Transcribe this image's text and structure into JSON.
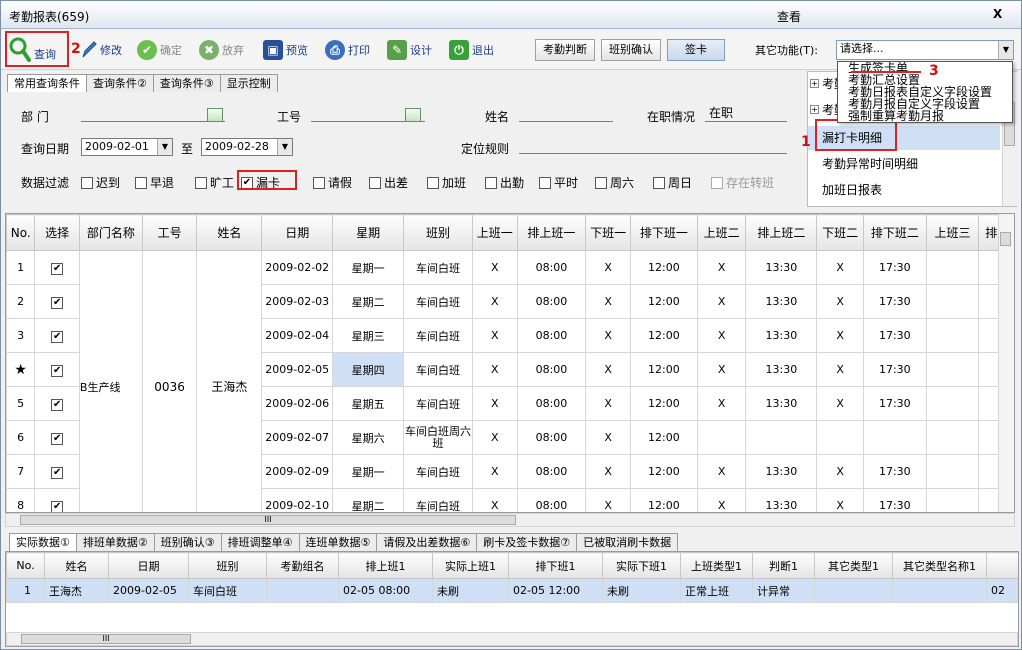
{
  "window": {
    "title": "考勤报表(659)",
    "center_title": "查看",
    "close_glyph": "X"
  },
  "toolbar": {
    "query": "查询",
    "edit": "修改",
    "confirm": "确定",
    "discard": "放弃",
    "preview": "预览",
    "print": "打印",
    "design": "设计",
    "exit": "退出",
    "judge": "考勤判断",
    "shift_confirm": "班别确认",
    "sign": "签卡",
    "other_label": "其它功能(T):",
    "other_value": "请选择..."
  },
  "annotations": {
    "n1": "1",
    "n2": "2",
    "n3": "3"
  },
  "query_tabs": [
    "常用查询条件",
    "查询条件②",
    "查询条件③",
    "显示控制"
  ],
  "query": {
    "dept_label": "部    门",
    "emp_no_label": "工号",
    "name_label": "姓名",
    "status_label": "在职情况",
    "status_value": "在职",
    "date_label": "查询日期",
    "date_from": "2009-02-01",
    "to": "至",
    "date_to": "2009-02-28",
    "rule_label": "定位规则",
    "filter_label": "数据过滤"
  },
  "filters": [
    {
      "label": "迟到",
      "checked": false,
      "disabled": false
    },
    {
      "label": "早退",
      "checked": false,
      "disabled": false
    },
    {
      "label": "旷工",
      "checked": false,
      "disabled": false
    },
    {
      "label": "漏卡",
      "checked": true,
      "disabled": false
    },
    {
      "label": "请假",
      "checked": false,
      "disabled": false
    },
    {
      "label": "出差",
      "checked": false,
      "disabled": false
    },
    {
      "label": "加班",
      "checked": false,
      "disabled": false
    },
    {
      "label": "出勤",
      "checked": false,
      "disabled": false
    },
    {
      "label": "平时",
      "checked": false,
      "disabled": false
    },
    {
      "label": "周六",
      "checked": false,
      "disabled": false
    },
    {
      "label": "周日",
      "checked": false,
      "disabled": false
    },
    {
      "label": "存在转班",
      "checked": false,
      "disabled": true
    }
  ],
  "report_list": [
    {
      "label": "考勤",
      "expand": "+"
    },
    {
      "label": "考勤",
      "expand": "+"
    },
    {
      "label": "漏打卡明细",
      "expand": ""
    },
    {
      "label": "考勤异常时间明细",
      "expand": ""
    },
    {
      "label": "加班日报表",
      "expand": ""
    }
  ],
  "popup_menu": [
    "生成签卡单",
    "考勤汇总设置",
    "考勤日报表自定义字段设置",
    "考勤月报自定义字段设置",
    "强制重算考勤月报"
  ],
  "grid": {
    "columns": [
      "No.",
      "选择",
      "部门名称",
      "工号",
      "姓名",
      "日期",
      "星期",
      "班别",
      "上班一",
      "排上班一",
      "下班一",
      "排下班一",
      "上班二",
      "排上班二",
      "下班二",
      "排下班二",
      "上班三",
      "排上"
    ],
    "group": {
      "dept": "B生产线",
      "emp_no": "0036",
      "name": "王海杰"
    },
    "current_row_marker": "★",
    "check_glyph": "✔",
    "rows": [
      {
        "no": "1",
        "date": "2009-02-02",
        "week": "星期一",
        "shift": "车间白班",
        "in1": "X",
        "sin1": "08:00",
        "out1": "X",
        "sout1": "12:00",
        "in2": "X",
        "sin2": "13:30",
        "out2": "X",
        "sout2": "17:30"
      },
      {
        "no": "2",
        "date": "2009-02-03",
        "week": "星期二",
        "shift": "车间白班",
        "in1": "X",
        "sin1": "08:00",
        "out1": "X",
        "sout1": "12:00",
        "in2": "X",
        "sin2": "13:30",
        "out2": "X",
        "sout2": "17:30"
      },
      {
        "no": "3",
        "date": "2009-02-04",
        "week": "星期三",
        "shift": "车间白班",
        "in1": "X",
        "sin1": "08:00",
        "out1": "X",
        "sout1": "12:00",
        "in2": "X",
        "sin2": "13:30",
        "out2": "X",
        "sout2": "17:30"
      },
      {
        "no": "★",
        "date": "2009-02-05",
        "week": "星期四",
        "shift": "车间白班",
        "in1": "X",
        "sin1": "08:00",
        "out1": "X",
        "sout1": "12:00",
        "in2": "X",
        "sin2": "13:30",
        "out2": "X",
        "sout2": "17:30"
      },
      {
        "no": "5",
        "date": "2009-02-06",
        "week": "星期五",
        "shift": "车间白班",
        "in1": "X",
        "sin1": "08:00",
        "out1": "X",
        "sout1": "12:00",
        "in2": "X",
        "sin2": "13:30",
        "out2": "X",
        "sout2": "17:30"
      },
      {
        "no": "6",
        "date": "2009-02-07",
        "week": "星期六",
        "shift": "车间白班周六班",
        "in1": "X",
        "sin1": "08:00",
        "out1": "X",
        "sout1": "12:00",
        "in2": "",
        "sin2": "",
        "out2": "",
        "sout2": ""
      },
      {
        "no": "7",
        "date": "2009-02-09",
        "week": "星期一",
        "shift": "车间白班",
        "in1": "X",
        "sin1": "08:00",
        "out1": "X",
        "sout1": "12:00",
        "in2": "X",
        "sin2": "13:30",
        "out2": "X",
        "sout2": "17:30"
      },
      {
        "no": "8",
        "date": "2009-02-10",
        "week": "星期二",
        "shift": "车间白班",
        "in1": "X",
        "sin1": "08:00",
        "out1": "X",
        "sout1": "12:00",
        "in2": "X",
        "sin2": "13:30",
        "out2": "X",
        "sout2": "17:30"
      }
    ]
  },
  "scroll": {
    "h_grip": "III"
  },
  "bottom_tabs": [
    "实际数据①",
    "排班单数据②",
    "班别确认③",
    "排班调整单④",
    "连班单数据⑤",
    "请假及出差数据⑥",
    "刷卡及签卡数据⑦",
    "已被取消刷卡数据"
  ],
  "detail": {
    "columns": [
      "No.",
      "姓名",
      "日期",
      "班别",
      "考勤组名",
      "排上班1",
      "实际上班1",
      "排下班1",
      "实际下班1",
      "上班类型1",
      "判断1",
      "其它类型1",
      "其它类型名称1",
      ""
    ],
    "row": [
      "1",
      "王海杰",
      "2009-02-05",
      "车间白班",
      "",
      "02-05 08:00",
      "未刷",
      "02-05 12:00",
      "未刷",
      "正常上班",
      "计异常",
      "",
      "",
      "02"
    ]
  }
}
